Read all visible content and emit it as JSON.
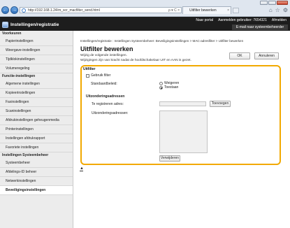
{
  "browser": {
    "address": "http://192.168.1.24/m_scr_macfilter_send.html",
    "tab_title": "Uitfilter bewerken",
    "nav_back": "←",
    "nav_forward": "→",
    "address_icons": "ρ ▾ C ×",
    "tool_icons": [
      "⌂",
      "☆",
      "⚙"
    ]
  },
  "header": {
    "brand": "Instellingen/registratie",
    "links": [
      "Naar portal",
      "Aanmelden gebruiker: 7654321",
      "Afmelden"
    ],
    "mail_button": "E-mail naar systeembeheerder"
  },
  "sidebar": {
    "sections": [
      {
        "heading": "Voorkeuren",
        "items": [
          {
            "label": "Papierinstellingen",
            "active": false
          },
          {
            "label": "Weergave-instellingen",
            "active": false
          },
          {
            "label": "Tijdklokinstellingen",
            "active": false
          },
          {
            "label": "Volumeregeling",
            "active": false
          }
        ]
      },
      {
        "heading": "Functie-instellingen",
        "items": [
          {
            "label": "Algemene instellingen",
            "active": false
          },
          {
            "label": "Kopieerinstellingen",
            "active": false
          },
          {
            "label": "Faxinstellingen",
            "active": false
          },
          {
            "label": "Scaninstellingen",
            "active": false
          },
          {
            "label": "Afdrukinstellingen geheugenmedia",
            "active": false
          },
          {
            "label": "Printerinstellingen",
            "active": false
          },
          {
            "label": "Instellingen afdrukrapport",
            "active": false
          },
          {
            "label": "Favoriete instellingen",
            "active": false
          }
        ]
      },
      {
        "heading": "Instellingen Systeembeheer",
        "items": [
          {
            "label": "Systeembeheer",
            "active": false
          },
          {
            "label": "Afdelings-ID beheer",
            "active": false
          },
          {
            "label": "Netwerkinstellingen",
            "active": false
          },
          {
            "label": "Beveiligingsinstellingen",
            "active": true
          }
        ]
      }
    ]
  },
  "main": {
    "breadcrumb": "Instellingen/registratie : Instellingen Systeembeheer: Beveiligingsinstellingen > MAC-adresfilter > Uitfilter bewerken",
    "title": "Uitfilter bewerken",
    "intro_line1": "Wijzig de volgende instellingen.",
    "intro_line2": "Wijzigingen zijn van kracht nadat de hoofdschakelaar UIT en AAN is gezet.",
    "ok_label": "OK",
    "cancel_label": "Annuleren",
    "panel_title": "Uitfilter",
    "use_filter_label": "Gebruik filter",
    "use_filter_checked": false,
    "standard_policy_label": "Standaardbeleid:",
    "policy_options": [
      {
        "label": "Weigeren",
        "selected": false
      },
      {
        "label": "Toestaan",
        "selected": true
      }
    ],
    "exception_section_title": "Uitzonderingsadressen",
    "register_label": "Te registreren adres:",
    "register_value": "",
    "add_label": "Toevoegen",
    "exceptions_label": "Uitzonderingsadressen:",
    "exceptions": [],
    "delete_label": "Verwijderen",
    "top_arrow": "▲"
  },
  "colors": {
    "header_bg": "#1d1d1d",
    "panel_border": "#f2a900",
    "sidebar_bg": "#ececec"
  }
}
